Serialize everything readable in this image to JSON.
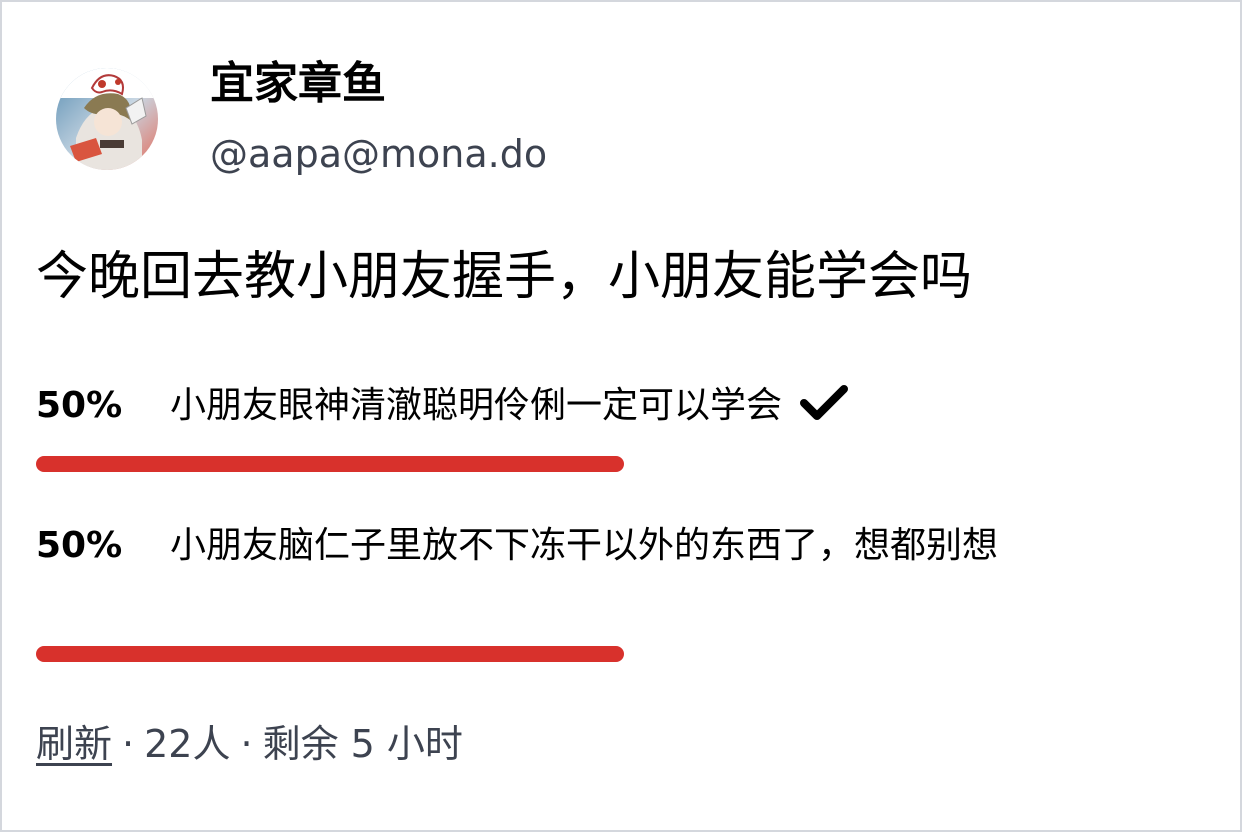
{
  "account": {
    "display_name": "宜家章鱼",
    "handle": "@aapa@mona.do",
    "avatar_icon": "anime-character-avatar"
  },
  "status": {
    "text": "今晚回去教小朋友握手，小朋友能学会吗"
  },
  "poll": {
    "bar_color": "#d8312c",
    "options": [
      {
        "percent_label": "50%",
        "percent": 50,
        "label": "小朋友眼神清澈聪明伶俐一定可以学会",
        "voted": true,
        "voted_icon": "check-icon"
      },
      {
        "percent_label": "50%",
        "percent": 50,
        "label": "小朋友脑仁子里放不下冻干以外的东西了，想都别想",
        "voted": false
      }
    ],
    "footer": {
      "refresh_label": "刷新",
      "separator": "·",
      "voters": "22人",
      "time_left": "剩余 5 小时"
    }
  }
}
